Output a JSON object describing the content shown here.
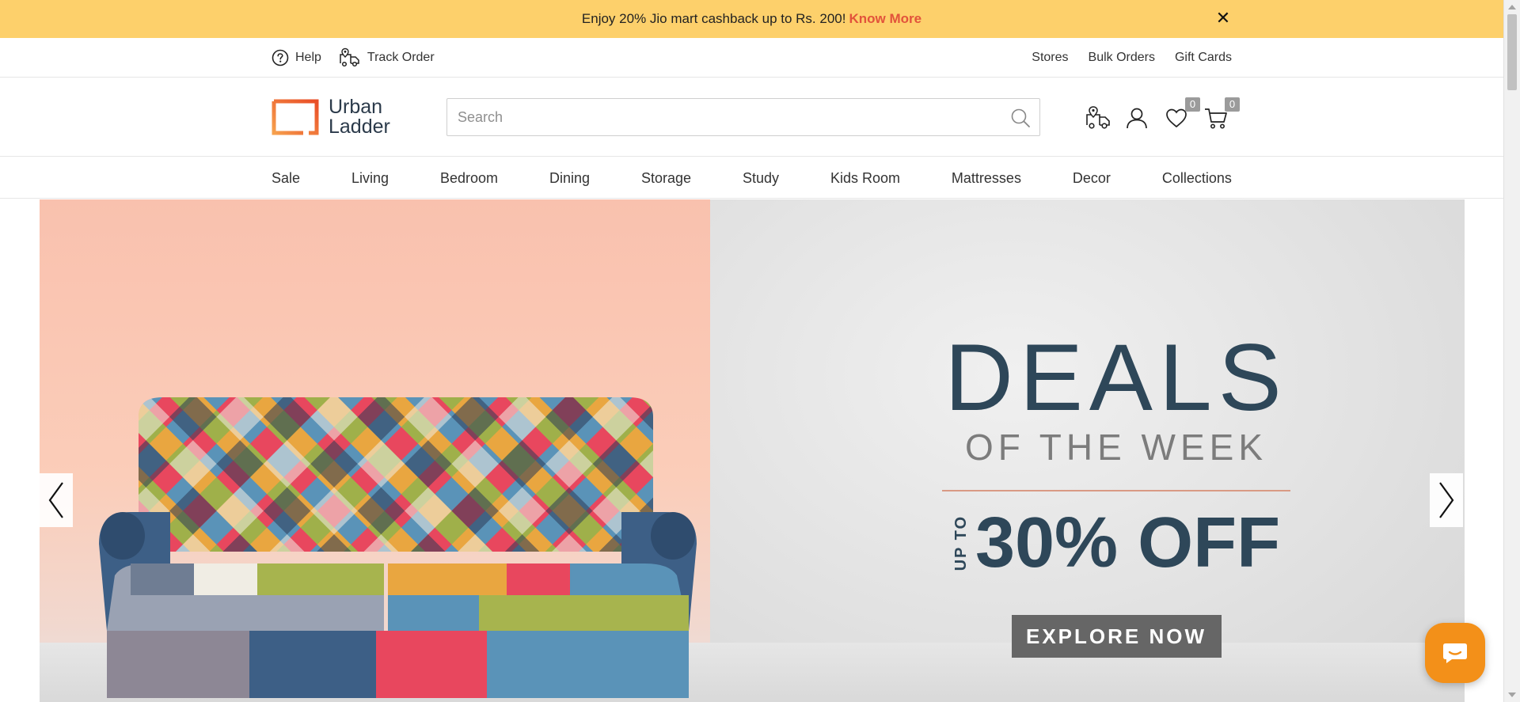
{
  "promo": {
    "text": "Enjoy 20% Jio mart cashback up to Rs. 200!",
    "link": "Know More",
    "close": "✕"
  },
  "utility": {
    "help": "Help",
    "track_order": "Track Order",
    "right_links": [
      "Stores",
      "Bulk Orders",
      "Gift Cards"
    ]
  },
  "header": {
    "logo_line1": "Urban",
    "logo_line2": "Ladder",
    "search_placeholder": "Search",
    "wishlist_count": "0",
    "cart_count": "0"
  },
  "nav": {
    "items": [
      "Sale",
      "Living",
      "Bedroom",
      "Dining",
      "Storage",
      "Study",
      "Kids Room",
      "Mattresses",
      "Decor",
      "Collections"
    ]
  },
  "hero": {
    "title": "DEALS",
    "subtitle": "OF THE WEEK",
    "upto": "UP TO",
    "offer": "30% OFF",
    "cta": "EXPLORE NOW"
  },
  "colors": {
    "promo_bg": "#fdd06b",
    "promo_link": "#e2533b",
    "brand_orange": "#f26f21",
    "brand_navy": "#2e4759",
    "chat": "#f39019"
  },
  "icons": {
    "help": "help-circle-icon",
    "track": "truck-pin-icon",
    "search": "search-icon",
    "delivery": "delivery-truck-icon",
    "profile": "user-icon",
    "wishlist": "heart-icon",
    "cart": "cart-icon",
    "prev": "chevron-left-icon",
    "next": "chevron-right-icon",
    "chat": "chat-bubble-icon"
  }
}
